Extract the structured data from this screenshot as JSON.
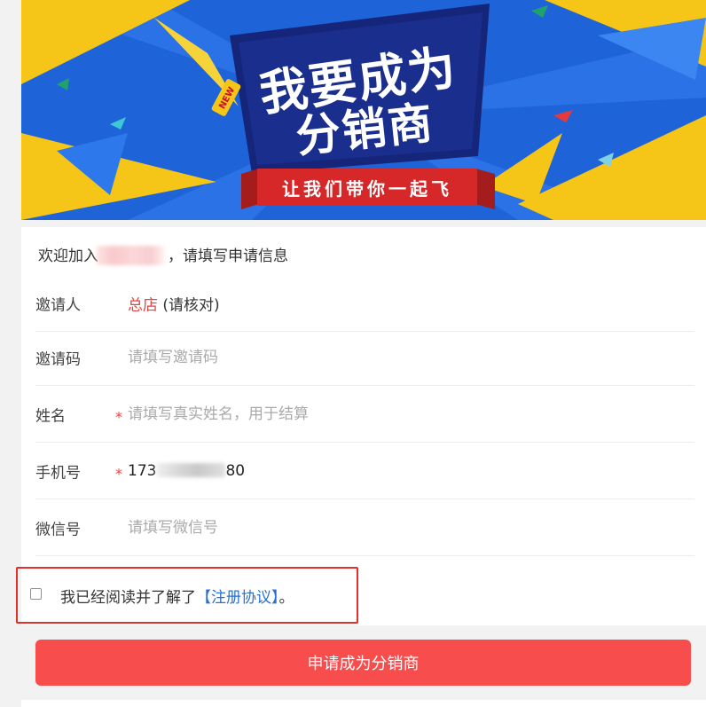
{
  "banner": {
    "title_line1": "我要成为",
    "title_line2": "分销商",
    "subtitle": "让我们带你一起飞",
    "badge": "NEW",
    "colors": {
      "background": "#1a5ed6",
      "yellow": "#f5c518",
      "navy": "#15257a",
      "red": "#d62828"
    }
  },
  "form": {
    "welcome_prefix": "欢迎加入",
    "welcome_suffix": "，请填写申请信息",
    "inviter": {
      "label": "邀请人",
      "name": "总店",
      "note": "(请核对)"
    },
    "invite_code": {
      "label": "邀请码",
      "placeholder": "请填写邀请码"
    },
    "name": {
      "label": "姓名",
      "required": "*",
      "placeholder": "请填写真实姓名，用于结算"
    },
    "phone": {
      "label": "手机号",
      "required": "*",
      "value_start": "173",
      "value_end": "80"
    },
    "wechat": {
      "label": "微信号",
      "placeholder": "请填写微信号"
    }
  },
  "agreement": {
    "text_before": "我已经阅读并了解了",
    "link_text": "【注册协议】",
    "text_after": "。",
    "checked": false
  },
  "submit": {
    "label": "申请成为分销商",
    "color": "#f74d4d"
  }
}
